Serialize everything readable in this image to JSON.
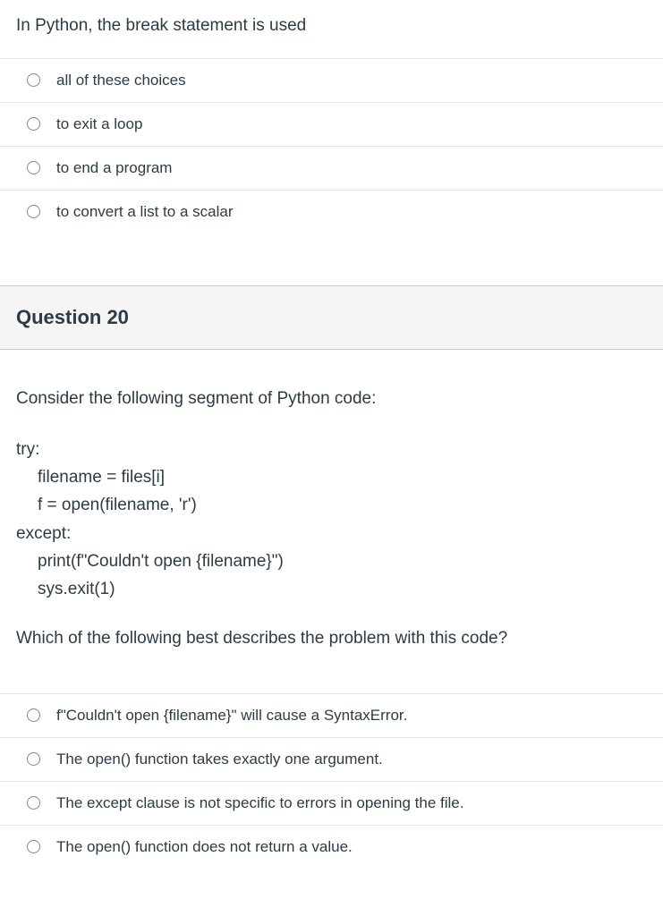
{
  "q19": {
    "prompt": "In Python, the break statement is used",
    "options": [
      "all of these choices",
      "to exit a loop",
      "to end a program",
      "to convert a list to a scalar"
    ]
  },
  "q20": {
    "header": "Question 20",
    "intro": "Consider the following segment of Python code:",
    "code": {
      "l1": "try:",
      "l2": "filename = files[i]",
      "l3": "f = open(filename, 'r')",
      "l4": "except:",
      "l5": "print(f\"Couldn't open {filename}\")",
      "l6": "sys.exit(1)"
    },
    "followup": "Which of the following best describes the problem with this code?",
    "options": [
      "f\"Couldn't open {filename}\" will cause a SyntaxError.",
      "The open() function takes exactly one argument.",
      "The except clause is not specific to errors in opening the file.",
      "The open() function does not return a value."
    ]
  }
}
